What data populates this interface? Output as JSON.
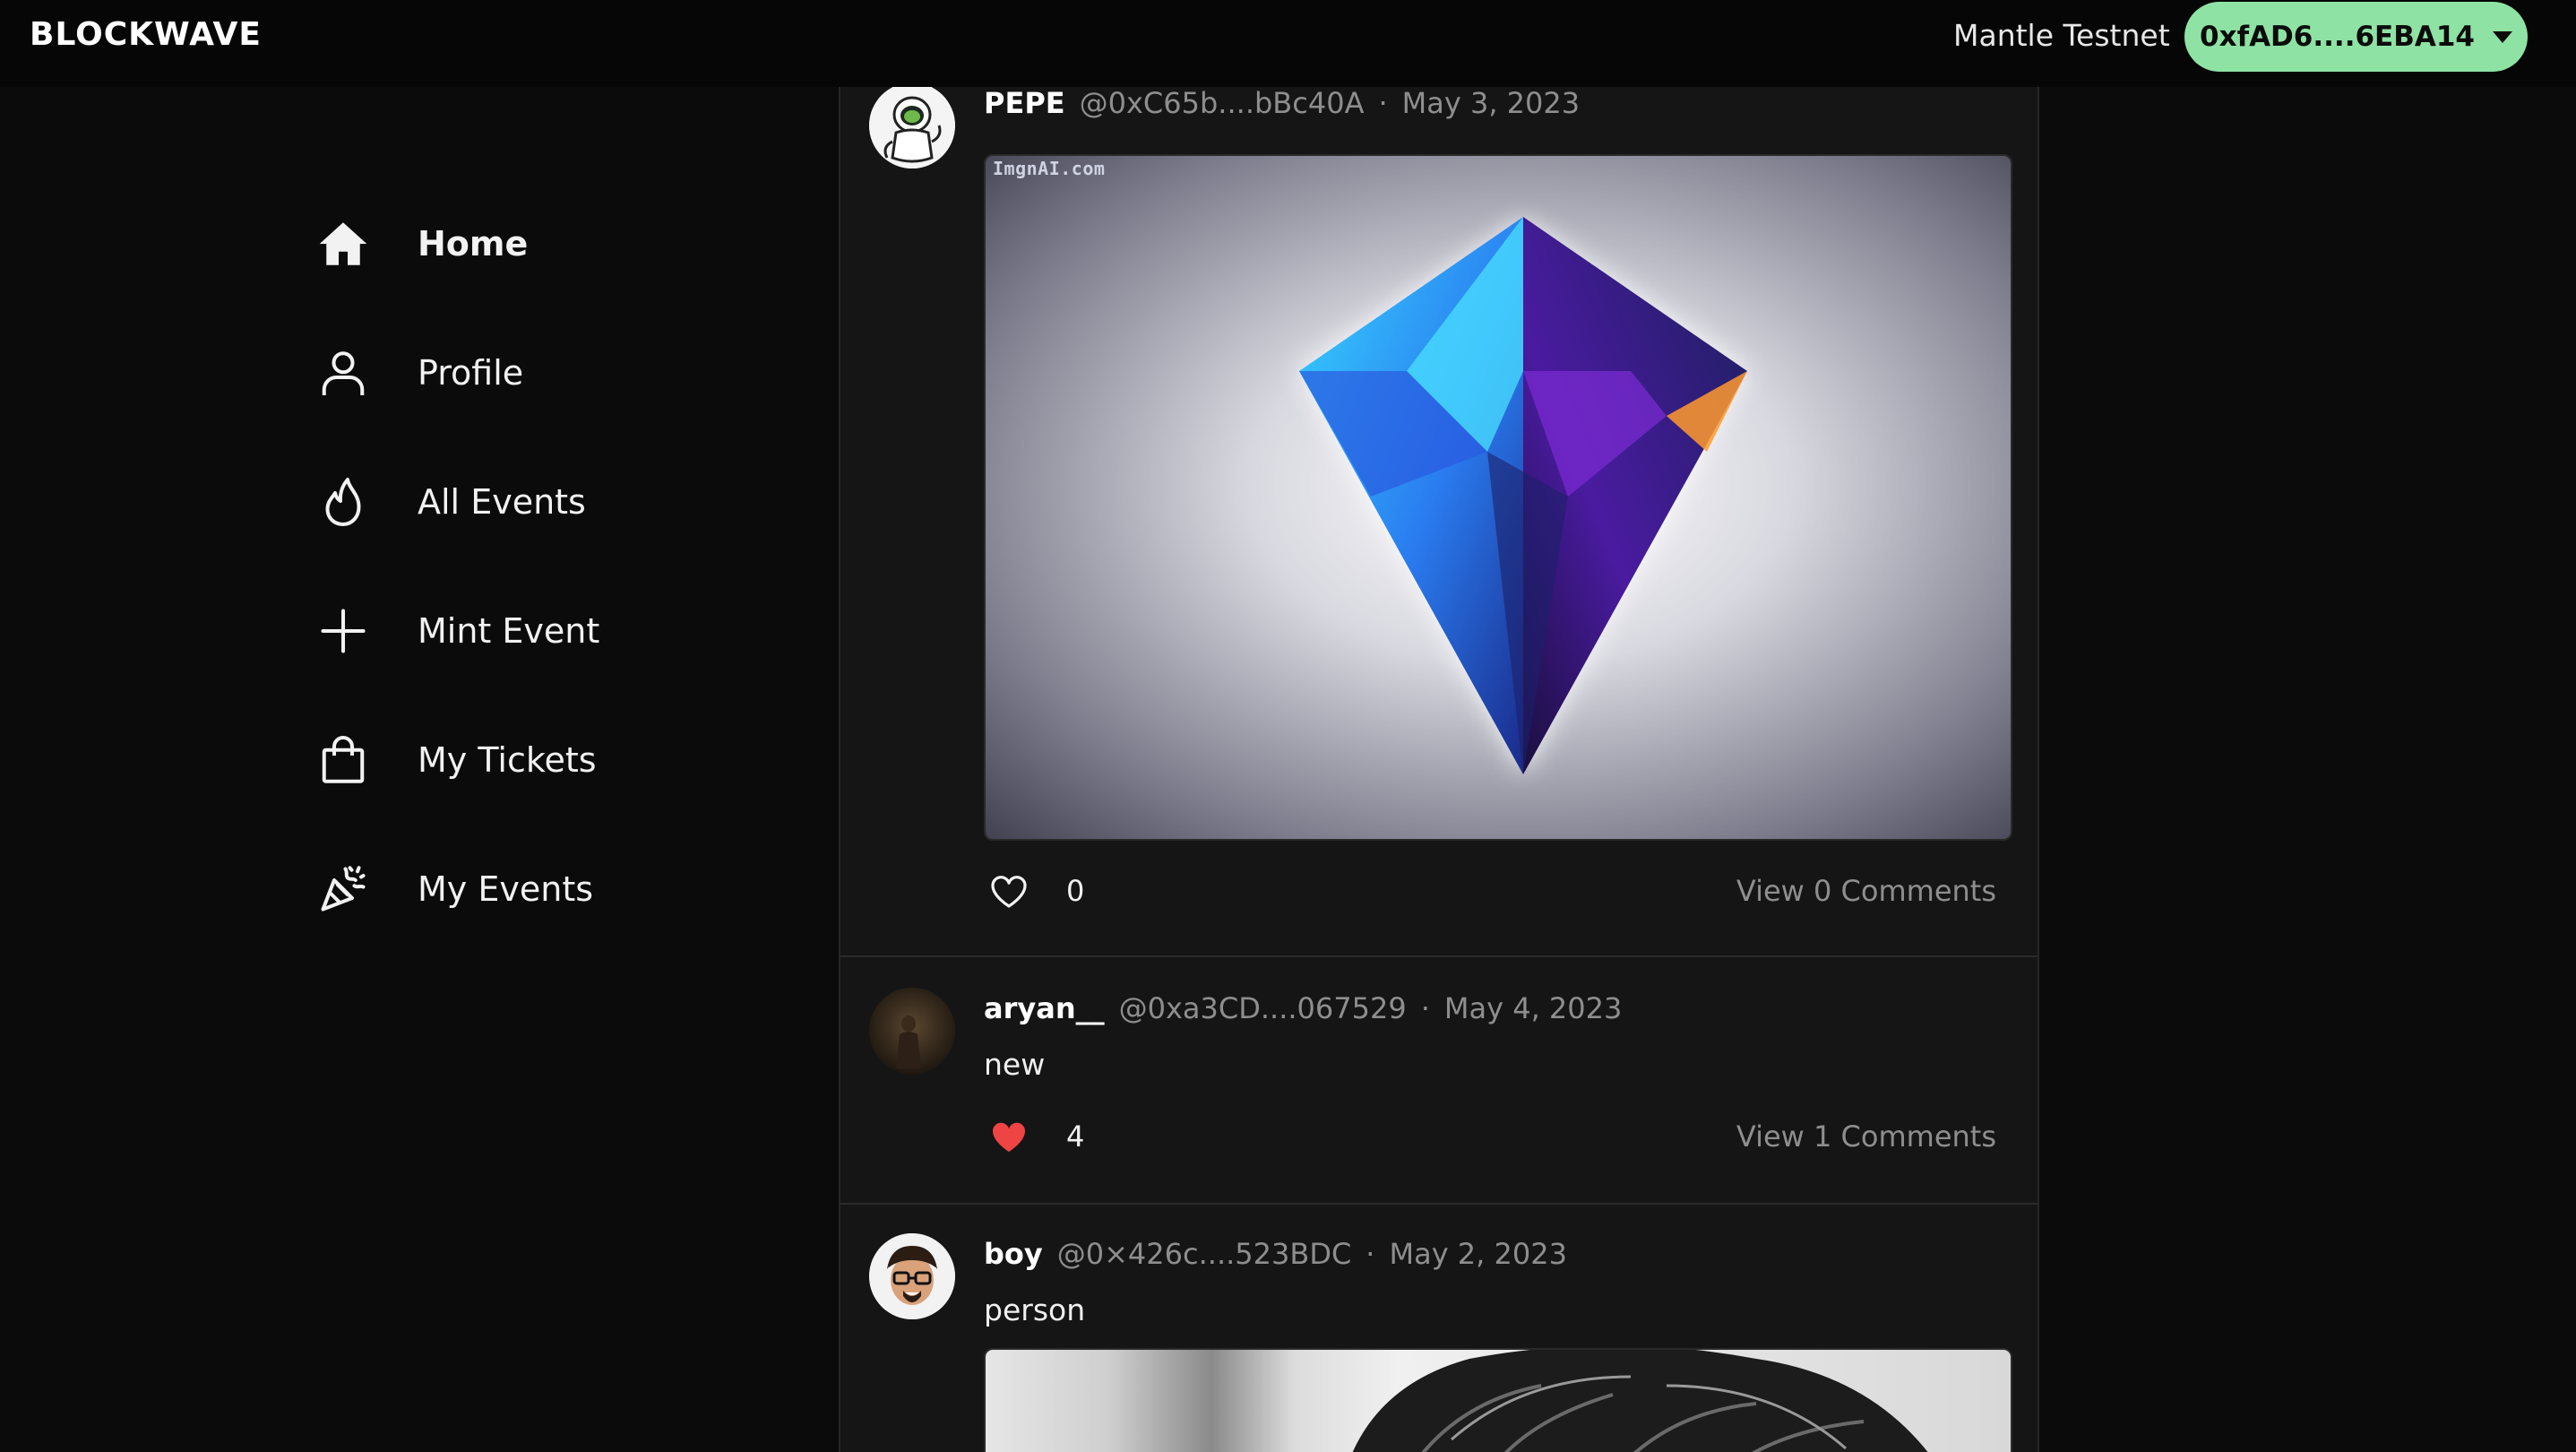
{
  "app": {
    "logo": "BLOCKWAVE"
  },
  "header": {
    "network": "Mantle Testnet",
    "wallet_address": "0xfAD6....6EBA14",
    "wallet_color": "#8ee3a4"
  },
  "sidebar": {
    "items": [
      {
        "label": "Home",
        "icon": "home-icon",
        "active": true
      },
      {
        "label": "Profile",
        "icon": "user-icon"
      },
      {
        "label": "All Events",
        "icon": "flame-icon"
      },
      {
        "label": "Mint Event",
        "icon": "plus-icon"
      },
      {
        "label": "My Tickets",
        "icon": "shopping-bag-icon"
      },
      {
        "label": "My Events",
        "icon": "party-popper-icon"
      }
    ]
  },
  "feed": {
    "posts": [
      {
        "username": "PEPE",
        "handle": "@0xC65b....bBc40A",
        "date": "May 3, 2023",
        "image_watermark": "ImgnAI.com",
        "likes": "0",
        "liked": false,
        "comments": "View 0 Comments"
      },
      {
        "username": "aryan__",
        "handle": "@0xa3CD....067529",
        "date": "May 4, 2023",
        "text": "new",
        "likes": "4",
        "liked": true,
        "comments": "View 1 Comments"
      },
      {
        "username": "boy",
        "handle": "@0×426c....523BDC",
        "date": "May 2, 2023",
        "text": "person"
      }
    ],
    "separator": "·",
    "like_color": "#ef4444"
  }
}
